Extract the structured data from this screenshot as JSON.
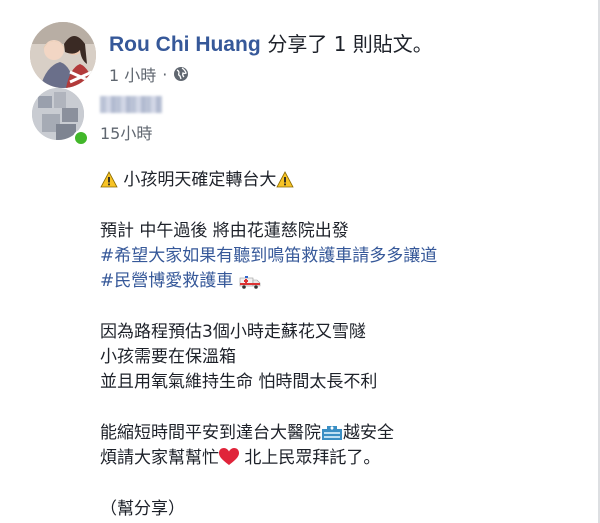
{
  "header": {
    "author_name": "Rou Chi Huang",
    "shared_text": "分享了 1 則貼文。",
    "time": "1 小時",
    "separator": "·",
    "privacy_icon": "globe-icon"
  },
  "shared_post": {
    "time": "15小時",
    "lines": [
      "小孩明天確定轉台大",
      "預計 中午過後 將由花蓮慈院出發",
      "#希望大家如果有聽到鳴笛救護車請多多讓道",
      "#民營博愛救護車",
      "因為路程預估3個小時走蘇花又雪隧",
      "小孩需要在保溫箱",
      "並且用氧氣維持生命 怕時間太長不利",
      "能縮短時間平安到達台大醫院",
      "越安全",
      "煩請大家幫幫忙",
      "北上民眾拜託了。",
      "（幫分享）"
    ],
    "emojis": [
      "warning-icon",
      "ambulance-icon",
      "hospital-icon",
      "heart-icon"
    ],
    "colors": {
      "hashtag": "#365899",
      "name": "#365899",
      "meta": "#606770"
    }
  }
}
